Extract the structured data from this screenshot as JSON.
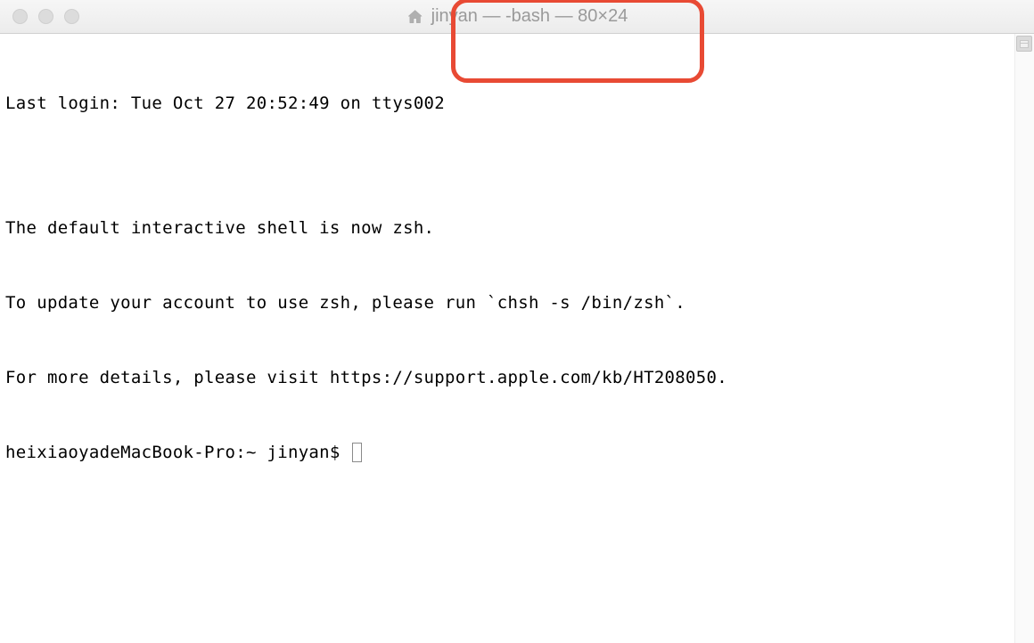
{
  "titlebar": {
    "title": "jinyan — -bash — 80×24"
  },
  "terminal": {
    "lines": [
      "Last login: Tue Oct 27 20:52:49 on ttys002",
      "",
      "The default interactive shell is now zsh.",
      "To update your account to use zsh, please run `chsh -s /bin/zsh`.",
      "For more details, please visit https://support.apple.com/kb/HT208050."
    ],
    "prompt": "heixiaoyadeMacBook-Pro:~ jinyan$ "
  }
}
